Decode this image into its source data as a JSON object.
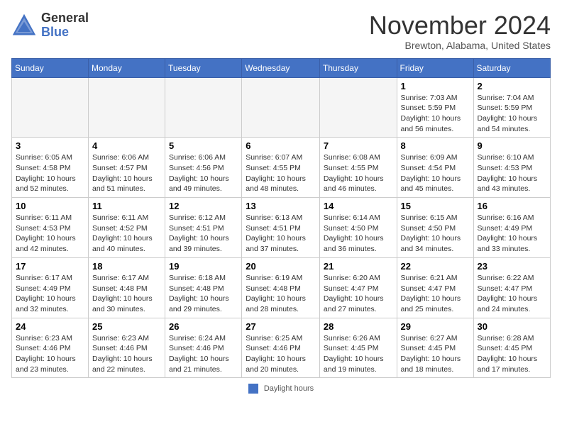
{
  "header": {
    "logo_general": "General",
    "logo_blue": "Blue",
    "month_title": "November 2024",
    "location": "Brewton, Alabama, United States"
  },
  "weekdays": [
    "Sunday",
    "Monday",
    "Tuesday",
    "Wednesday",
    "Thursday",
    "Friday",
    "Saturday"
  ],
  "footer": {
    "legend_label": "Daylight hours"
  },
  "weeks": [
    [
      {
        "day": "",
        "empty": true
      },
      {
        "day": "",
        "empty": true
      },
      {
        "day": "",
        "empty": true
      },
      {
        "day": "",
        "empty": true
      },
      {
        "day": "",
        "empty": true
      },
      {
        "day": "1",
        "sunrise": "Sunrise: 7:03 AM",
        "sunset": "Sunset: 5:59 PM",
        "daylight": "Daylight: 10 hours and 56 minutes."
      },
      {
        "day": "2",
        "sunrise": "Sunrise: 7:04 AM",
        "sunset": "Sunset: 5:59 PM",
        "daylight": "Daylight: 10 hours and 54 minutes."
      }
    ],
    [
      {
        "day": "3",
        "sunrise": "Sunrise: 6:05 AM",
        "sunset": "Sunset: 4:58 PM",
        "daylight": "Daylight: 10 hours and 52 minutes."
      },
      {
        "day": "4",
        "sunrise": "Sunrise: 6:06 AM",
        "sunset": "Sunset: 4:57 PM",
        "daylight": "Daylight: 10 hours and 51 minutes."
      },
      {
        "day": "5",
        "sunrise": "Sunrise: 6:06 AM",
        "sunset": "Sunset: 4:56 PM",
        "daylight": "Daylight: 10 hours and 49 minutes."
      },
      {
        "day": "6",
        "sunrise": "Sunrise: 6:07 AM",
        "sunset": "Sunset: 4:55 PM",
        "daylight": "Daylight: 10 hours and 48 minutes."
      },
      {
        "day": "7",
        "sunrise": "Sunrise: 6:08 AM",
        "sunset": "Sunset: 4:55 PM",
        "daylight": "Daylight: 10 hours and 46 minutes."
      },
      {
        "day": "8",
        "sunrise": "Sunrise: 6:09 AM",
        "sunset": "Sunset: 4:54 PM",
        "daylight": "Daylight: 10 hours and 45 minutes."
      },
      {
        "day": "9",
        "sunrise": "Sunrise: 6:10 AM",
        "sunset": "Sunset: 4:53 PM",
        "daylight": "Daylight: 10 hours and 43 minutes."
      }
    ],
    [
      {
        "day": "10",
        "sunrise": "Sunrise: 6:11 AM",
        "sunset": "Sunset: 4:53 PM",
        "daylight": "Daylight: 10 hours and 42 minutes."
      },
      {
        "day": "11",
        "sunrise": "Sunrise: 6:11 AM",
        "sunset": "Sunset: 4:52 PM",
        "daylight": "Daylight: 10 hours and 40 minutes."
      },
      {
        "day": "12",
        "sunrise": "Sunrise: 6:12 AM",
        "sunset": "Sunset: 4:51 PM",
        "daylight": "Daylight: 10 hours and 39 minutes."
      },
      {
        "day": "13",
        "sunrise": "Sunrise: 6:13 AM",
        "sunset": "Sunset: 4:51 PM",
        "daylight": "Daylight: 10 hours and 37 minutes."
      },
      {
        "day": "14",
        "sunrise": "Sunrise: 6:14 AM",
        "sunset": "Sunset: 4:50 PM",
        "daylight": "Daylight: 10 hours and 36 minutes."
      },
      {
        "day": "15",
        "sunrise": "Sunrise: 6:15 AM",
        "sunset": "Sunset: 4:50 PM",
        "daylight": "Daylight: 10 hours and 34 minutes."
      },
      {
        "day": "16",
        "sunrise": "Sunrise: 6:16 AM",
        "sunset": "Sunset: 4:49 PM",
        "daylight": "Daylight: 10 hours and 33 minutes."
      }
    ],
    [
      {
        "day": "17",
        "sunrise": "Sunrise: 6:17 AM",
        "sunset": "Sunset: 4:49 PM",
        "daylight": "Daylight: 10 hours and 32 minutes."
      },
      {
        "day": "18",
        "sunrise": "Sunrise: 6:17 AM",
        "sunset": "Sunset: 4:48 PM",
        "daylight": "Daylight: 10 hours and 30 minutes."
      },
      {
        "day": "19",
        "sunrise": "Sunrise: 6:18 AM",
        "sunset": "Sunset: 4:48 PM",
        "daylight": "Daylight: 10 hours and 29 minutes."
      },
      {
        "day": "20",
        "sunrise": "Sunrise: 6:19 AM",
        "sunset": "Sunset: 4:48 PM",
        "daylight": "Daylight: 10 hours and 28 minutes."
      },
      {
        "day": "21",
        "sunrise": "Sunrise: 6:20 AM",
        "sunset": "Sunset: 4:47 PM",
        "daylight": "Daylight: 10 hours and 27 minutes."
      },
      {
        "day": "22",
        "sunrise": "Sunrise: 6:21 AM",
        "sunset": "Sunset: 4:47 PM",
        "daylight": "Daylight: 10 hours and 25 minutes."
      },
      {
        "day": "23",
        "sunrise": "Sunrise: 6:22 AM",
        "sunset": "Sunset: 4:47 PM",
        "daylight": "Daylight: 10 hours and 24 minutes."
      }
    ],
    [
      {
        "day": "24",
        "sunrise": "Sunrise: 6:23 AM",
        "sunset": "Sunset: 4:46 PM",
        "daylight": "Daylight: 10 hours and 23 minutes."
      },
      {
        "day": "25",
        "sunrise": "Sunrise: 6:23 AM",
        "sunset": "Sunset: 4:46 PM",
        "daylight": "Daylight: 10 hours and 22 minutes."
      },
      {
        "day": "26",
        "sunrise": "Sunrise: 6:24 AM",
        "sunset": "Sunset: 4:46 PM",
        "daylight": "Daylight: 10 hours and 21 minutes."
      },
      {
        "day": "27",
        "sunrise": "Sunrise: 6:25 AM",
        "sunset": "Sunset: 4:46 PM",
        "daylight": "Daylight: 10 hours and 20 minutes."
      },
      {
        "day": "28",
        "sunrise": "Sunrise: 6:26 AM",
        "sunset": "Sunset: 4:45 PM",
        "daylight": "Daylight: 10 hours and 19 minutes."
      },
      {
        "day": "29",
        "sunrise": "Sunrise: 6:27 AM",
        "sunset": "Sunset: 4:45 PM",
        "daylight": "Daylight: 10 hours and 18 minutes."
      },
      {
        "day": "30",
        "sunrise": "Sunrise: 6:28 AM",
        "sunset": "Sunset: 4:45 PM",
        "daylight": "Daylight: 10 hours and 17 minutes."
      }
    ]
  ]
}
